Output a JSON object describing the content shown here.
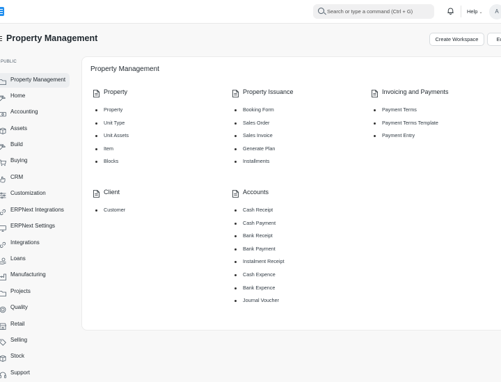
{
  "navbar": {
    "search_placeholder": "Search or type a command (Ctrl + G)",
    "help_label": "Help",
    "avatar_initial": "A"
  },
  "page": {
    "title": "Property Management",
    "create_workspace_label": "Create Workspace",
    "edit_label": "Edit"
  },
  "sidebar": {
    "heading": "PUBLIC",
    "items": [
      {
        "label": "Property Management",
        "icon": "folder-icon",
        "active": true
      },
      {
        "label": "Home",
        "icon": "tools-icon"
      },
      {
        "label": "Accounting",
        "icon": "money-icon"
      },
      {
        "label": "Assets",
        "icon": "box-icon"
      },
      {
        "label": "Build",
        "icon": "tools-icon"
      },
      {
        "label": "Buying",
        "icon": "cart-icon"
      },
      {
        "label": "CRM",
        "icon": "hand-icon"
      },
      {
        "label": "Customization",
        "icon": "sliders-icon"
      },
      {
        "label": "ERPNext Integrations",
        "icon": "link-icon"
      },
      {
        "label": "ERPNext Settings",
        "icon": "monitor-icon"
      },
      {
        "label": "Integrations",
        "icon": "link-icon"
      },
      {
        "label": "Loans",
        "icon": "hand-coin-icon"
      },
      {
        "label": "Manufacturing",
        "icon": "factory-icon"
      },
      {
        "label": "Projects",
        "icon": "folder-icon"
      },
      {
        "label": "Quality",
        "icon": "badge-icon"
      },
      {
        "label": "Retail",
        "icon": "store-icon"
      },
      {
        "label": "Selling",
        "icon": "tag-icon"
      },
      {
        "label": "Stock",
        "icon": "box-icon"
      },
      {
        "label": "Support",
        "icon": "headset-icon"
      }
    ]
  },
  "card": {
    "title": "Property Management",
    "sections": [
      {
        "title": "Property",
        "links": [
          "Property",
          "Unit Type",
          "Unit Assets",
          "Item",
          "Blocks"
        ]
      },
      {
        "title": "Property Issuance",
        "links": [
          "Booking Form",
          "Sales Order",
          "Sales Invoice",
          "Generate Plan",
          "Installments"
        ]
      },
      {
        "title": "Invoicing and Payments",
        "links": [
          "Payment Terms",
          "Payment Terms Template",
          "Payment Entry"
        ]
      },
      {
        "title": "Client",
        "links": [
          "Customer"
        ]
      },
      {
        "title": "Accounts",
        "links": [
          "Cash Receipt",
          "Cash Payment",
          "Bank Receipt",
          "Bank Payment",
          "Instalment Receipt",
          "Cash Expence",
          "Bank Expence",
          "Journal Voucher"
        ]
      }
    ]
  }
}
